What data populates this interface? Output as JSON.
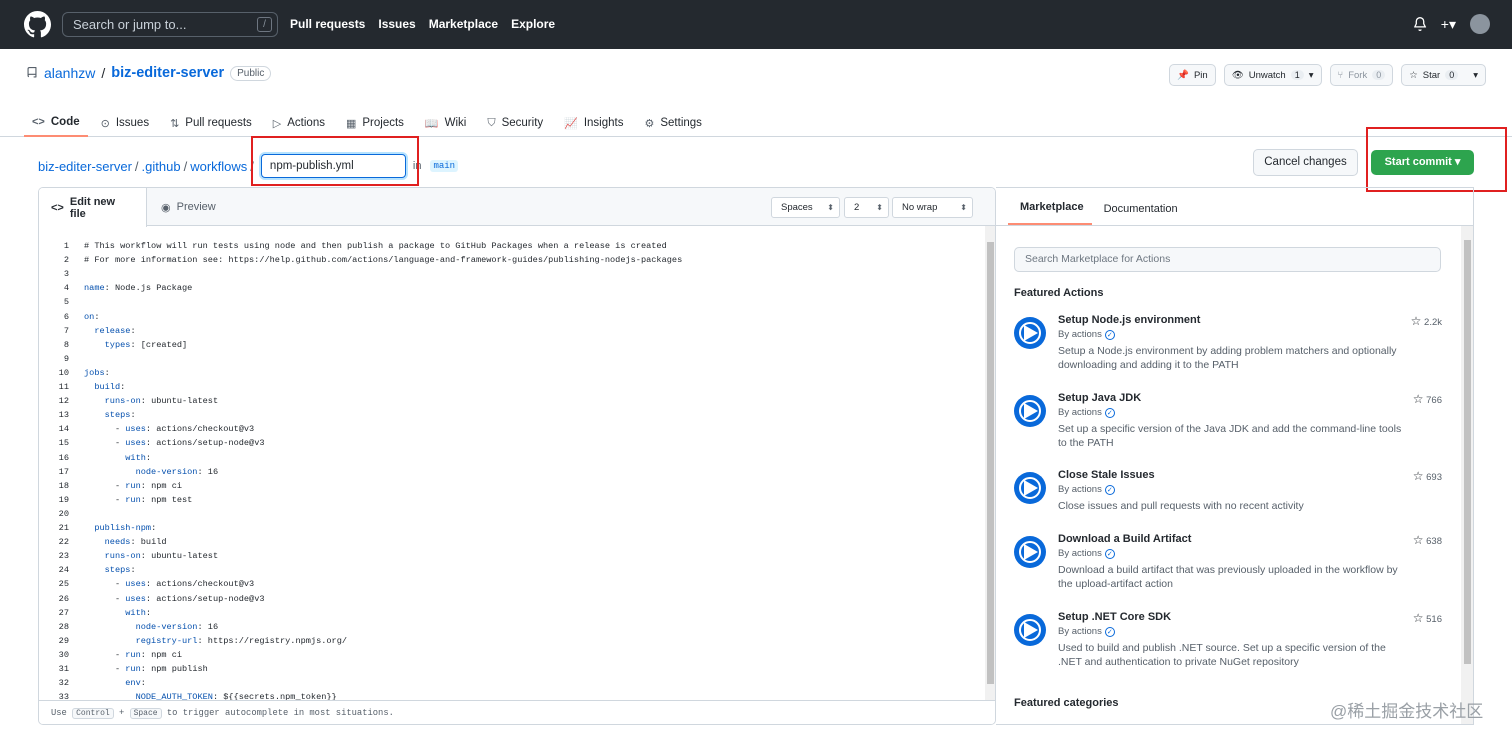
{
  "topbar": {
    "search_placeholder": "Search or jump to...",
    "search_key": "/",
    "nav": [
      "Pull requests",
      "Issues",
      "Marketplace",
      "Explore"
    ],
    "icons": [
      "bell-icon",
      "plus-icon",
      "avatar"
    ]
  },
  "repo": {
    "owner": "alanhzw",
    "sep": "/",
    "name": "biz-editer-server",
    "visibility": "Public",
    "pin_label": "Pin",
    "unwatch_label": "Unwatch",
    "unwatch_count": "1",
    "fork_label": "Fork",
    "fork_count": "0",
    "star_label": "Star",
    "star_count": "0"
  },
  "tabs": [
    "Code",
    "Issues",
    "Pull requests",
    "Actions",
    "Projects",
    "Wiki",
    "Security",
    "Insights",
    "Settings"
  ],
  "breadcrumb": {
    "root": "biz-editer-server",
    "folder1": ".github",
    "folder2": "workflows",
    "sep": "/",
    "filename": "npm-publish.yml",
    "in": "in",
    "branch": "main"
  },
  "buttons": {
    "cancel": "Cancel changes",
    "commit": "Start commit"
  },
  "editor": {
    "tab_edit": "Edit new file",
    "tab_preview": "Preview",
    "indent_mode": "Spaces",
    "indent_size": "2",
    "wrap_mode": "No wrap",
    "footer_use": "Use",
    "footer_key1": "Control",
    "footer_plus": "+",
    "footer_key2": "Space",
    "footer_rest": "to trigger autocomplete in most situations.",
    "lines": [
      "# This workflow will run tests using node and then publish a package to GitHub Packages when a release is created",
      "# For more information see: https://help.github.com/actions/language-and-framework-guides/publishing-nodejs-packages",
      "",
      "name: Node.js Package",
      "",
      "on:",
      "  release:",
      "    types: [created]",
      "",
      "jobs:",
      "  build:",
      "    runs-on: ubuntu-latest",
      "    steps:",
      "      - uses: actions/checkout@v3",
      "      - uses: actions/setup-node@v3",
      "        with:",
      "          node-version: 16",
      "      - run: npm ci",
      "      - run: npm test",
      "",
      "  publish-npm:",
      "    needs: build",
      "    runs-on: ubuntu-latest",
      "    steps:",
      "      - uses: actions/checkout@v3",
      "      - uses: actions/setup-node@v3",
      "        with:",
      "          node-version: 16",
      "          registry-url: https://registry.npmjs.org/",
      "      - run: npm ci",
      "      - run: npm publish",
      "        env:",
      "          NODE_AUTH_TOKEN: ${{secrets.npm_token}}"
    ]
  },
  "sidebar": {
    "tab_marketplace": "Marketplace",
    "tab_docs": "Documentation",
    "search_placeholder": "Search Marketplace for Actions",
    "featured_actions": "Featured Actions",
    "featured_categories": "Featured categories",
    "actions": [
      {
        "name": "Setup Node.js environment",
        "by": "By actions",
        "desc": "Setup a Node.js environment by adding problem matchers and optionally downloading and adding it to the PATH",
        "stars": "2.2k"
      },
      {
        "name": "Setup Java JDK",
        "by": "By actions",
        "desc": "Set up a specific version of the Java JDK and add the command-line tools to the PATH",
        "stars": "766"
      },
      {
        "name": "Close Stale Issues",
        "by": "By actions",
        "desc": "Close issues and pull requests with no recent activity",
        "stars": "693"
      },
      {
        "name": "Download a Build Artifact",
        "by": "By actions",
        "desc": "Download a build artifact that was previously uploaded in the workflow by the upload-artifact action",
        "stars": "638"
      },
      {
        "name": "Setup .NET Core SDK",
        "by": "By actions",
        "desc": "Used to build and publish .NET source. Set up a specific version of the .NET and authentication to private NuGet repository",
        "stars": "516"
      }
    ]
  },
  "watermark": "@稀土掘金技术社区"
}
